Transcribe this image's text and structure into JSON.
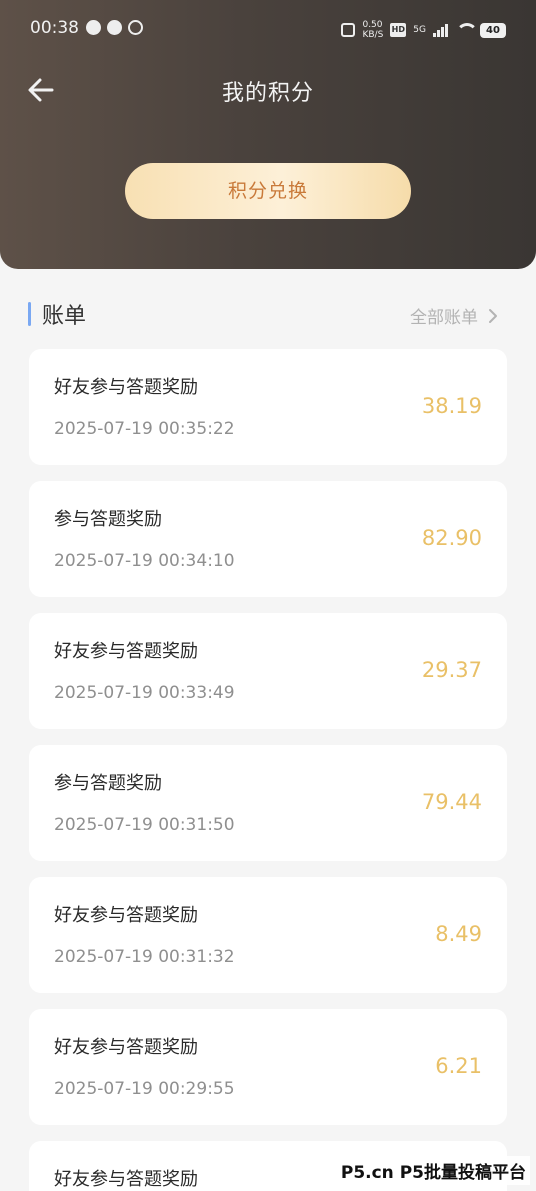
{
  "status_bar": {
    "time": "00:38",
    "net_speed": "0.50\nKB/S",
    "hd_label": "HD",
    "signal_label": "5G",
    "battery": "40"
  },
  "header": {
    "title": "我的积分",
    "exchange_label": "积分兑换"
  },
  "bills": {
    "section_title": "账单",
    "all_link": "全部账单",
    "items": [
      {
        "title": "好友参与答题奖励",
        "time": "2025-07-19 00:35:22",
        "amount": "38.19"
      },
      {
        "title": "参与答题奖励",
        "time": "2025-07-19 00:34:10",
        "amount": "82.90"
      },
      {
        "title": "好友参与答题奖励",
        "time": "2025-07-19 00:33:49",
        "amount": "29.37"
      },
      {
        "title": "参与答题奖励",
        "time": "2025-07-19 00:31:50",
        "amount": "79.44"
      },
      {
        "title": "好友参与答题奖励",
        "time": "2025-07-19 00:31:32",
        "amount": "8.49"
      },
      {
        "title": "好友参与答题奖励",
        "time": "2025-07-19 00:29:55",
        "amount": "6.21"
      },
      {
        "title": "好友参与答题奖励",
        "time": "",
        "amount": ""
      }
    ]
  },
  "watermark": "P5.cn P5批量投稿平台",
  "colors": {
    "accent_amount": "#e9c067",
    "exchange_text": "#c97a3a",
    "section_bar": "#7aa8f2"
  }
}
